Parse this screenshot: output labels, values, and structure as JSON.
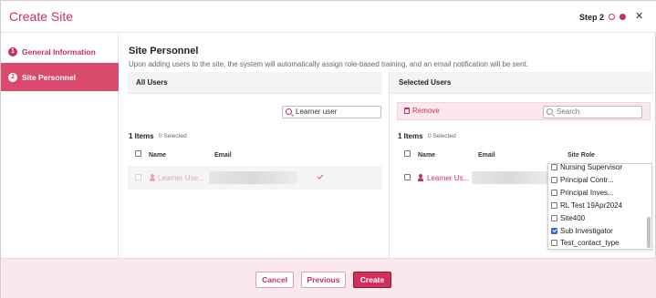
{
  "colors": {
    "accent": "#c8315a",
    "active_step_bg": "#d94a6d",
    "footer_bg": "#fbe8ed",
    "create_button": "#d32f5b"
  },
  "header": {
    "title": "Create Site",
    "step_label": "Step 2"
  },
  "sidebar": {
    "items": [
      {
        "number": "1",
        "label": "General Information",
        "active": false
      },
      {
        "number": "2",
        "label": "Site Personnel",
        "active": true
      }
    ]
  },
  "main": {
    "title": "Site Personnel",
    "description": "Upon adding users to the site, the system will automatically assign role-based training, and an email notification will be sent."
  },
  "all_users": {
    "header": "All Users",
    "search_value": "Learner user",
    "items_count": "1 Items",
    "selected_count": "0 Selected",
    "columns": {
      "name": "Name",
      "email": "Email"
    },
    "rows": [
      {
        "name": "Learner Use..."
      }
    ]
  },
  "selected_users": {
    "header": "Selected Users",
    "remove_label": "Remove",
    "search_placeholder": "Search",
    "items_count": "1 Items",
    "selected_count": "0 Selected",
    "columns": {
      "name": "Name",
      "email": "Email",
      "role": "Site Role"
    },
    "rows": [
      {
        "name": "Learner Us..."
      }
    ]
  },
  "role_dropdown": {
    "options": [
      {
        "label": "Nursing Supervisor",
        "checked": false
      },
      {
        "label": "Principal Contr...",
        "checked": false
      },
      {
        "label": "Principal Inves...",
        "checked": false
      },
      {
        "label": "RL Test 19Apr2024",
        "checked": false
      },
      {
        "label": "Site400",
        "checked": false
      },
      {
        "label": "Sub Investigator",
        "checked": true
      },
      {
        "label": "Test_contact_type",
        "checked": false
      }
    ]
  },
  "footer": {
    "cancel_label": "Cancel",
    "previous_label": "Previous",
    "create_label": "Create"
  }
}
